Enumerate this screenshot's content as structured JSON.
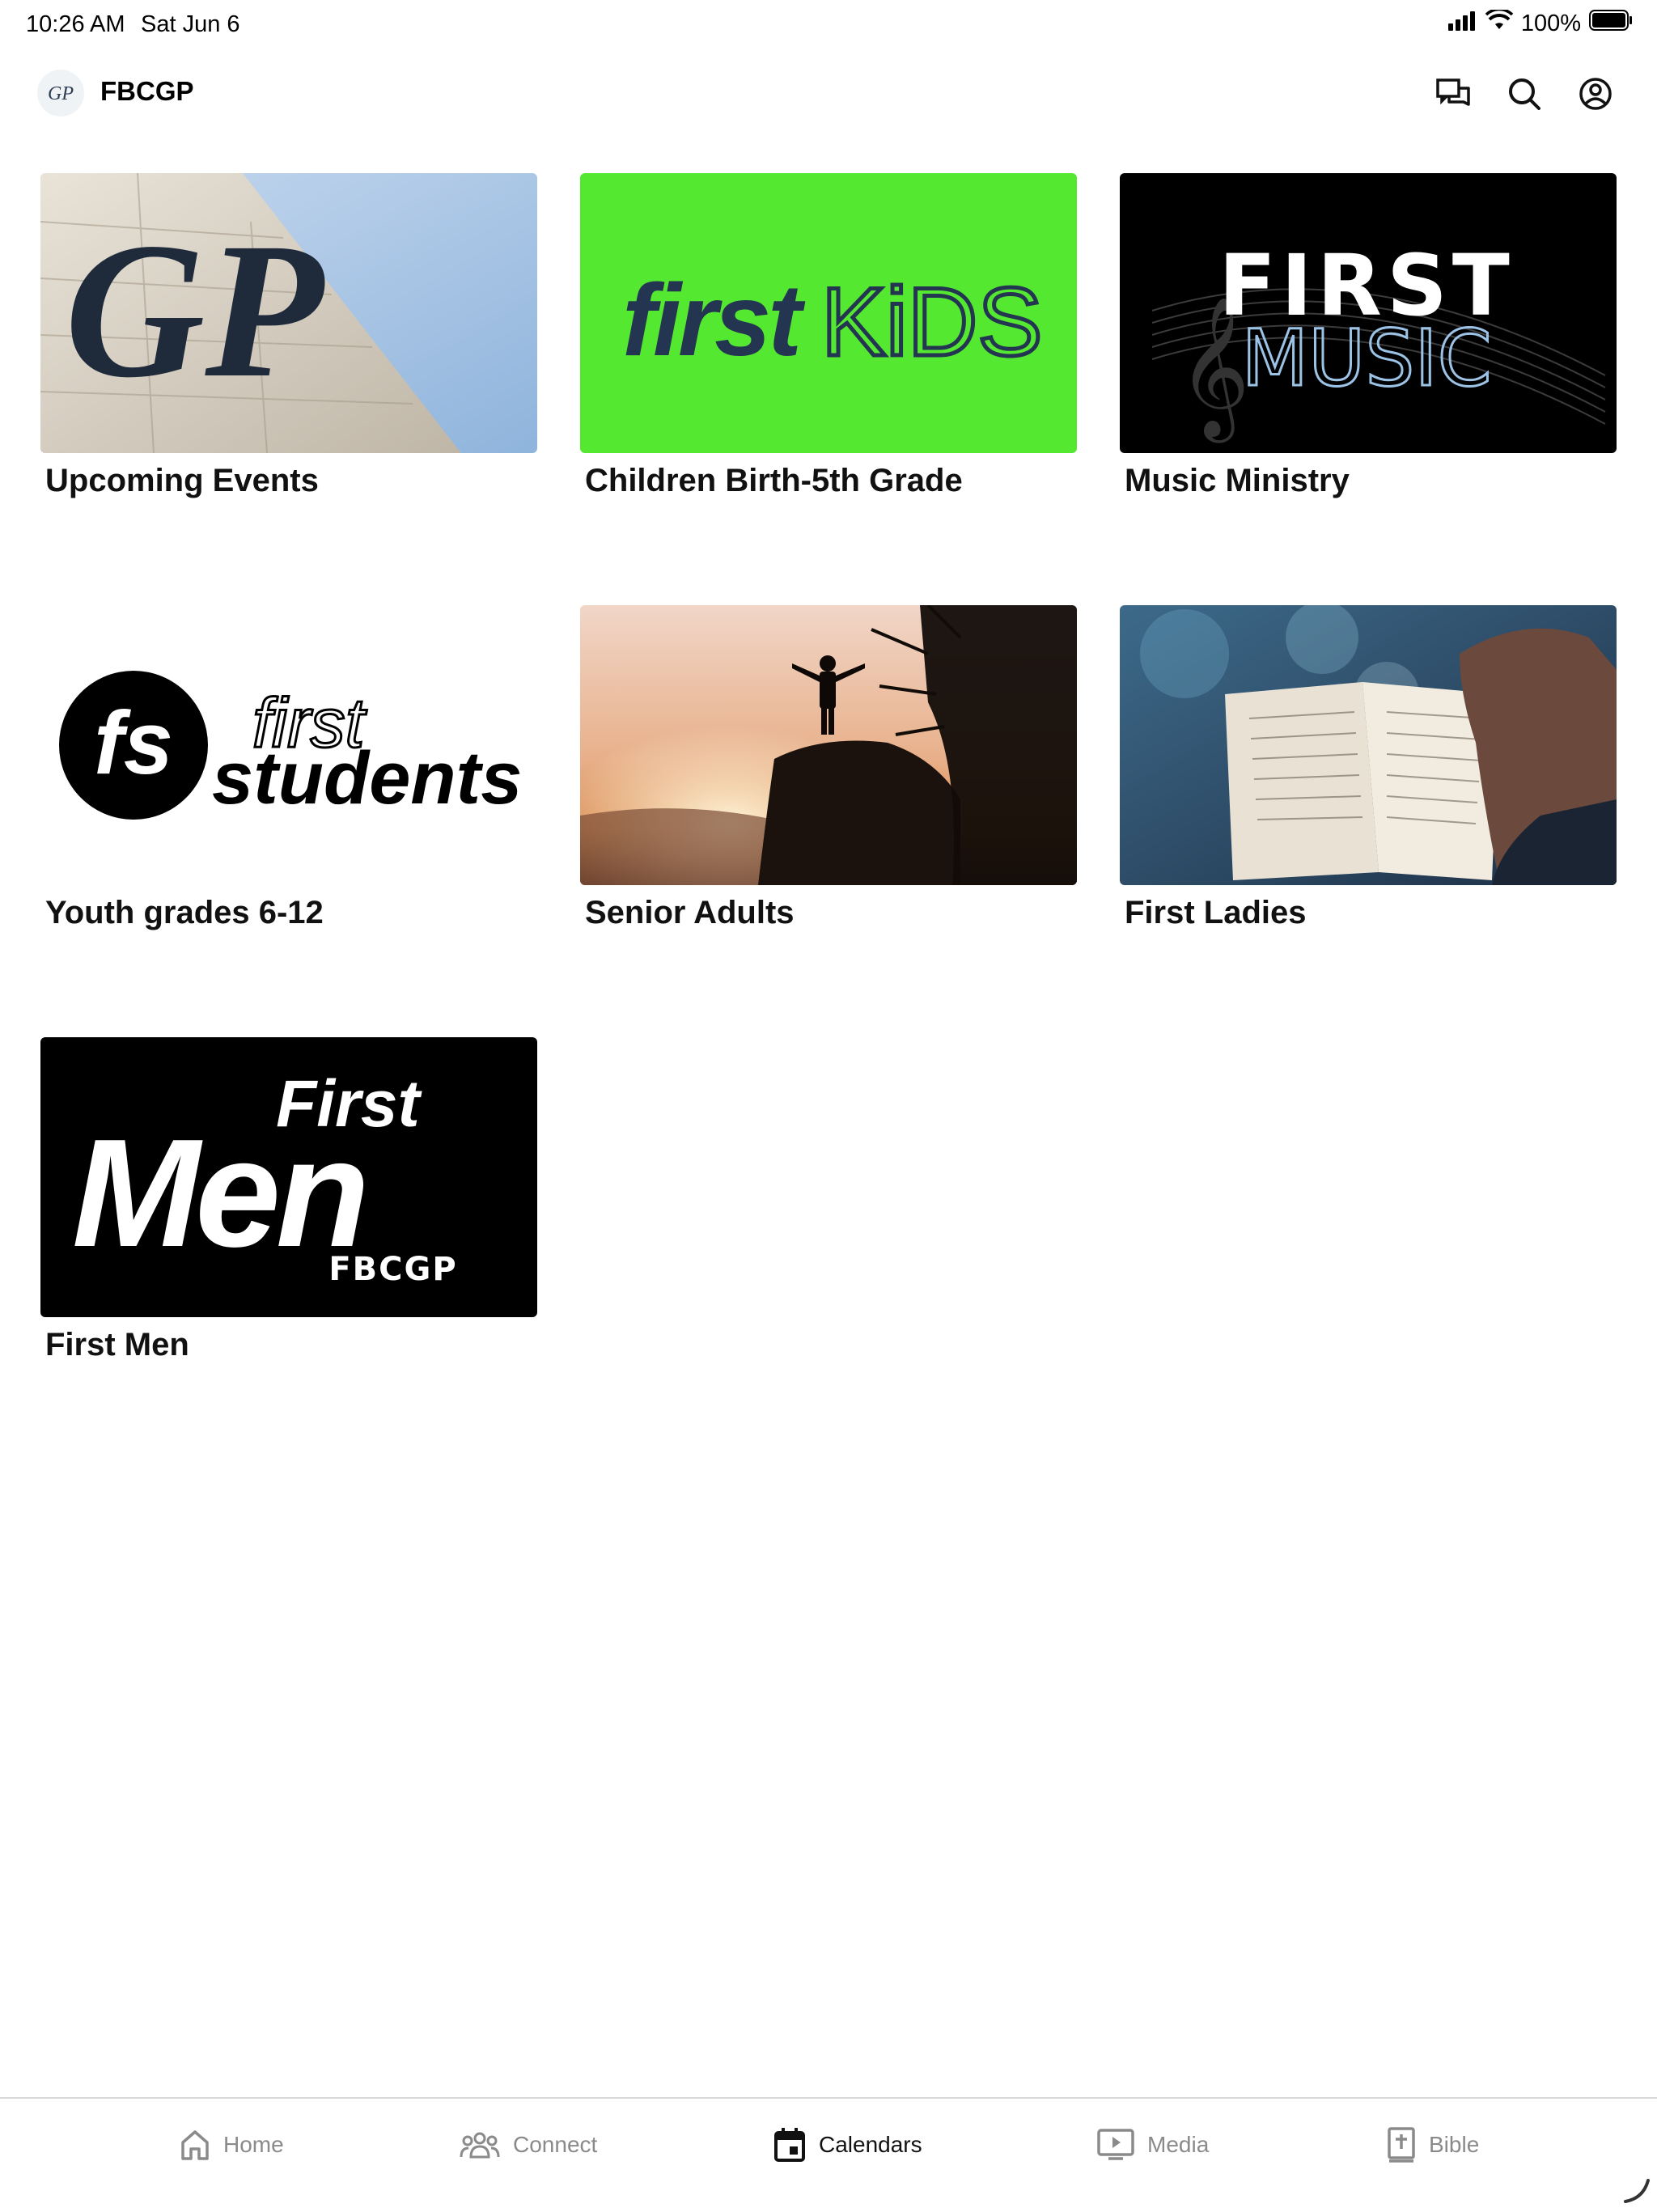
{
  "status_bar": {
    "time": "10:26 AM",
    "date": "Sat Jun 6",
    "battery": "100%"
  },
  "header": {
    "title": "FBCGP",
    "logo_text": "GP"
  },
  "cards": [
    {
      "label": "Upcoming Events",
      "image_text": "GP"
    },
    {
      "label": "Children Birth-5th Grade",
      "image_text_1": "first",
      "image_text_2": "KiDS"
    },
    {
      "label": "Music Ministry",
      "image_text_1": "FIRST",
      "image_text_2": "MUSIC"
    },
    {
      "label": "Youth grades 6-12",
      "image_text_1": "fs",
      "image_text_2": "first",
      "image_text_3": "students"
    },
    {
      "label": "Senior Adults"
    },
    {
      "label": "First Ladies"
    },
    {
      "label": "First Men",
      "image_text_1": "First",
      "image_text_2": "Men",
      "image_text_3": "FBCGP"
    }
  ],
  "tabs": [
    {
      "label": "Home",
      "icon": "home-icon"
    },
    {
      "label": "Connect",
      "icon": "people-icon"
    },
    {
      "label": "Calendars",
      "icon": "calendar-icon",
      "active": true
    },
    {
      "label": "Media",
      "icon": "play-icon"
    },
    {
      "label": "Bible",
      "icon": "bible-icon"
    }
  ],
  "colors": {
    "kids_green": "#55e831",
    "kids_navy": "#243552",
    "music_blue": "#9cc3e6",
    "tab_inactive": "#8a8a8a"
  }
}
